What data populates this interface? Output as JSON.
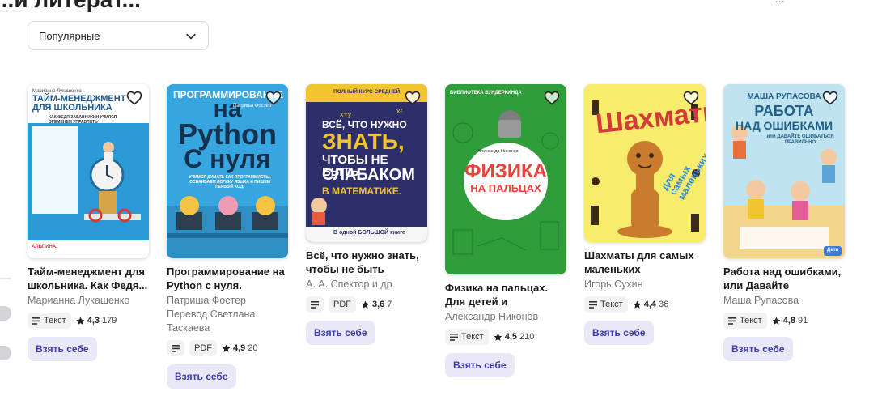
{
  "header": {
    "title": "...и литерат...",
    "right_link": "..."
  },
  "sort": {
    "selected": "Популярные"
  },
  "books": [
    {
      "title": "Тайм-менеджмент для школьника. Как Федя...",
      "author": "Марианна Лукашенко",
      "translator": "",
      "format": "Текст",
      "rating": "4,3",
      "count": "179",
      "button": "Взять себе",
      "cover": {
        "top_text": "Марианна Лукашенко",
        "big_text": "ТАЙМ-МЕНЕДЖМЕНТ ДЛЯ ШКОЛЬНИКА",
        "sub_text": "КАК ФЕДЯ ЗАБАВНИКИН УЧИЛСЯ ВРЕМЕНЕМ УПРАВЛЯТЬ",
        "publisher": "АЛЬПИНА"
      }
    },
    {
      "title": "Программирование на Python с нуля. Учимся...",
      "author": "Патриша Фостер",
      "translator": "Перевод Светлана Таскаева",
      "format": "PDF",
      "rating": "4,9",
      "count": "20",
      "button": "Взять себе",
      "cover": {
        "line1": "ПРОГРАММИРОВАНИЕ",
        "line2": "на",
        "line3": "Python",
        "line4": "С нуля",
        "author": "Патриша Фостер",
        "sub_text": "УЧИМСЯ ДУМАТЬ КАК ПРОГРАММИСТЫ, ОСВАИВАЕМ ЛОГИКУ ЯЗЫКА И ПИШЕМ ПЕРВЫЙ КОД!"
      }
    },
    {
      "title": "Всё, что нужно знать, чтобы не быть слабаком ...",
      "author": "А. А. Спектор и др.",
      "translator": "",
      "format": "PDF",
      "rating": "3,6",
      "count": "7",
      "button": "Взять себе",
      "cover": {
        "top_text": "ПОЛНЫЙ КУРС СРЕДНЕЙ",
        "l1": "ВСЁ, ЧТО НУЖНО",
        "l2": "ЗНАТЬ,",
        "l3": "ЧТОБЫ НЕ БЫТЬ",
        "l4": "СЛАБАКОМ",
        "l5": "В МАТЕМАТИКЕ.",
        "bottom": "В одной БОЛЬШОЙ книге"
      }
    },
    {
      "title": "Физика на пальцах. Для детей и родителей,...",
      "author": "Александр Никонов",
      "translator": "",
      "format": "Текст",
      "rating": "4,5",
      "count": "210",
      "button": "Взять себе",
      "cover": {
        "top_text": "БИБЛИОТЕКА ВУНДЕРКИНДА",
        "author": "Александр Никонов",
        "l1": "ФИЗИКА",
        "l2": "НА ПАЛЬЦАХ"
      }
    },
    {
      "title": "Шахматы для самых маленьких",
      "author": "Игорь Сухин",
      "translator": "",
      "format": "Текст",
      "rating": "4,4",
      "count": "36",
      "button": "Взять себе",
      "cover": {
        "l1": "Шахматы",
        "l2": "для самых маленьких"
      }
    },
    {
      "title": "Работа над ошибками, или Давайте ошибаться...",
      "author": "Маша Рупасова",
      "translator": "",
      "format": "Текст",
      "rating": "4,8",
      "count": "91",
      "button": "Взять себе",
      "cover": {
        "author": "МАША РУПАСОВА",
        "l1": "РАБОТА",
        "l2": "НАД ОШИБКАМИ",
        "l3": "или ДАВАЙТЕ ОШИБАТЬСЯ ПРАВИЛЬНО",
        "publisher": "Дети"
      }
    }
  ],
  "colors": {
    "accent_button_bg": "#e9e8f7",
    "accent_button_text": "#3b3aa8"
  }
}
